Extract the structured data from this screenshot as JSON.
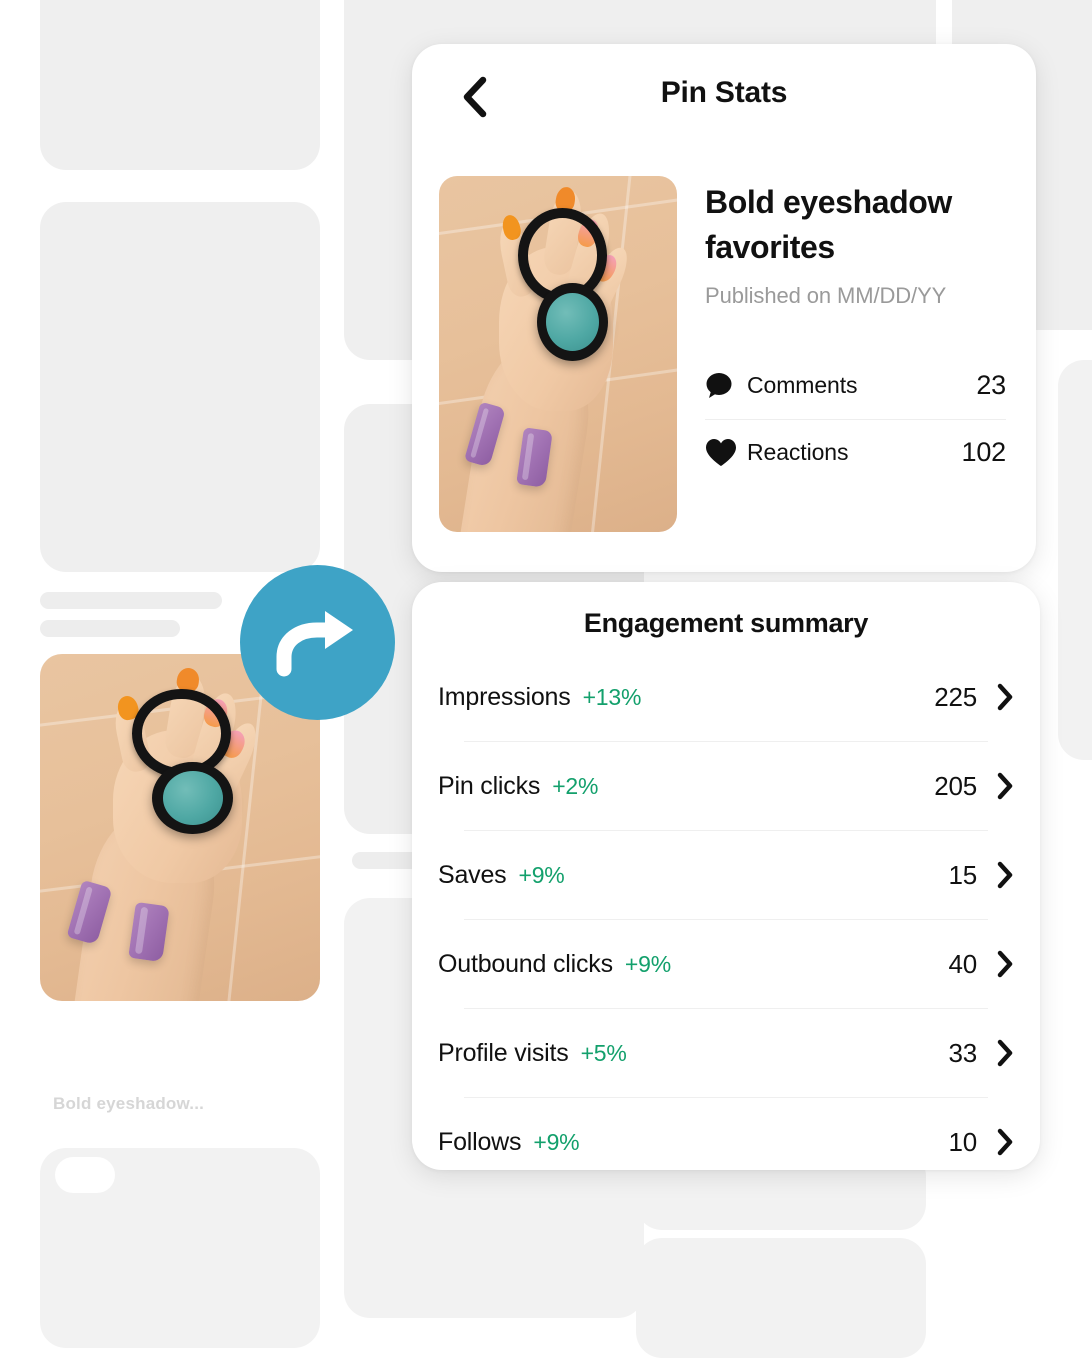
{
  "background_feed": {
    "caption": "Bold eyeshadow...",
    "placeholder_color": "#efefef"
  },
  "share_button": {
    "icon": "share-arrow-icon",
    "color": "#3ea3c6"
  },
  "pin_stats_card": {
    "back_icon": "chevron-left-icon",
    "title": "Pin Stats",
    "pin": {
      "title": "Bold eyeshadow favorites",
      "published": "Published on MM/DD/YY",
      "image_alt": "hand-holding-eyeshadow-compact"
    },
    "stats": [
      {
        "icon": "comment-bubble-icon",
        "label": "Comments",
        "value": "23"
      },
      {
        "icon": "heart-icon",
        "label": "Reactions",
        "value": "102"
      }
    ]
  },
  "engagement_card": {
    "title": "Engagement summary",
    "chevron_icon": "chevron-right-icon",
    "delta_color": "#13a06c",
    "rows": [
      {
        "label": "Impressions",
        "delta": "+13%",
        "value": "225"
      },
      {
        "label": "Pin clicks",
        "delta": "+2%",
        "value": "205"
      },
      {
        "label": "Saves",
        "delta": "+9%",
        "value": "15"
      },
      {
        "label": "Outbound clicks",
        "delta": "+9%",
        "value": "40"
      },
      {
        "label": "Profile visits",
        "delta": "+5%",
        "value": "33"
      },
      {
        "label": "Follows",
        "delta": "+9%",
        "value": "10"
      }
    ]
  }
}
